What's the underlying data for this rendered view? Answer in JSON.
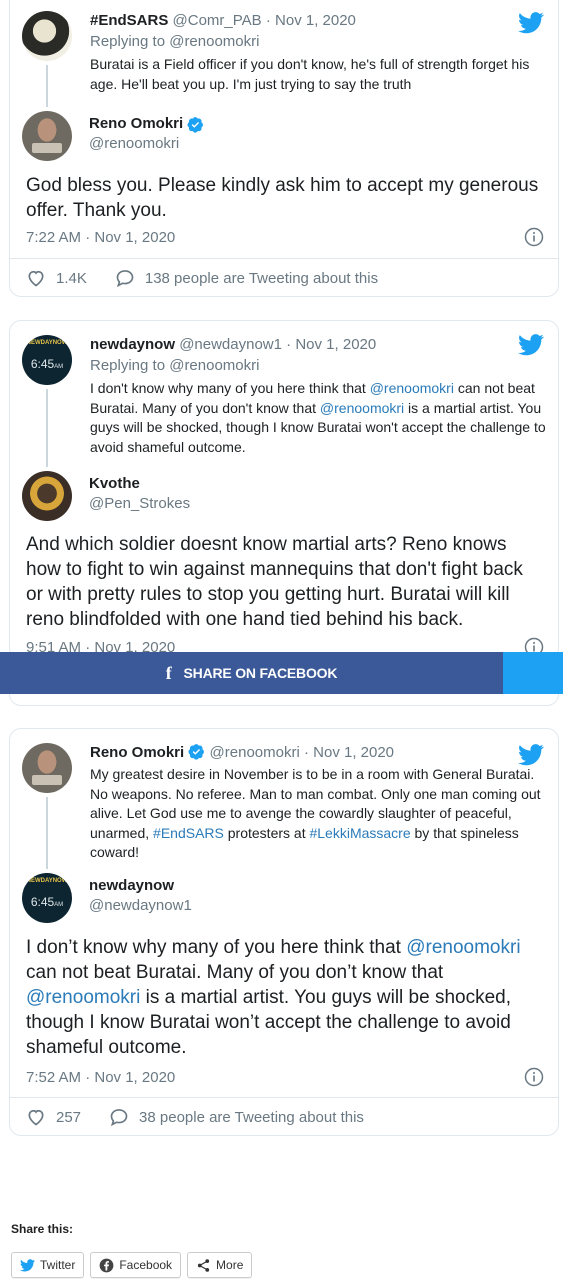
{
  "embed1": {
    "quote": {
      "name": "#EndSARS",
      "handle": "@Comr_PAB",
      "date": "Nov 1, 2020",
      "replying_to": "Replying to @renoomokri",
      "text": "Buratai is a Field officer if you don't know, he's full of strength forget his age. He'll beat you up. I'm just trying to say the truth"
    },
    "author": {
      "name": "Reno Omokri",
      "handle": "@renoomokri"
    },
    "text": "God bless you. Please kindly ask him to accept my generous offer. Thank you.",
    "time": "7:22 AM · Nov 1, 2020",
    "likes": "1.4K",
    "tweeting": "138 people are Tweeting about this"
  },
  "embed2": {
    "quote": {
      "name": "newdaynow",
      "handle": "@newdaynow1",
      "date": "Nov 1, 2020",
      "replying_to": "Replying to @renoomokri",
      "text_parts": [
        "I don't know why many of you here think that ",
        "@renoomokri",
        " can not beat Buratai. Many of you don't know that ",
        "@renoomokri",
        " is a martial artist. You guys will be shocked, though I know Buratai won't accept the challenge to avoid shameful outcome."
      ],
      "avatar_top": "NEWDAYNOW",
      "avatar_time": "6:45",
      "avatar_ampm": "AM"
    },
    "author": {
      "name": "Kvothe",
      "handle": "@Pen_Strokes"
    },
    "text": "And which soldier doesnt know martial arts? Reno knows how to fight to win against mannequins that don't fight back or with pretty rules to stop you getting hurt. Buratai will kill reno blindfolded with one hand tied behind his back.",
    "time": "9:51 AM · Nov 1, 2020"
  },
  "facebook_bar": {
    "icon": "f",
    "label": "SHARE ON FACEBOOK"
  },
  "embed3": {
    "quote": {
      "name": "Reno Omokri",
      "handle": "@renoomokri",
      "date": "Nov 1, 2020",
      "text_parts": [
        "My greatest desire in November is to be in a room with General Buratai. No weapons. No referee. Man to man combat. Only one man coming out alive. Let God use me to avenge the cowardly slaughter of peaceful, unarmed, ",
        "#EndSARS",
        " protesters at ",
        "#LekkiMassacre",
        " by that spineless coward!"
      ]
    },
    "author": {
      "name": "newdaynow",
      "handle": "@newdaynow1",
      "avatar_top": "NEWDAYNOW",
      "avatar_time": "6:45",
      "avatar_ampm": "AM"
    },
    "text_parts": [
      "I don’t know why many of you here think that ",
      "@renoomokri",
      " can not beat Buratai. Many of you don’t know that ",
      "@renoomokri",
      " is a martial artist. You guys will be shocked, though I know Buratai won’t accept the challenge to avoid shameful outcome."
    ],
    "time": "7:52 AM · Nov 1, 2020",
    "likes": "257",
    "tweeting": "38 people are Tweeting about this"
  },
  "share": {
    "title": "Share this:",
    "buttons": [
      "Twitter",
      "Facebook",
      "More"
    ]
  },
  "colors": {
    "twitter_blue": "#1da1f2",
    "link": "#2b7bb9",
    "facebook": "#3b5998",
    "muted": "#697882"
  }
}
